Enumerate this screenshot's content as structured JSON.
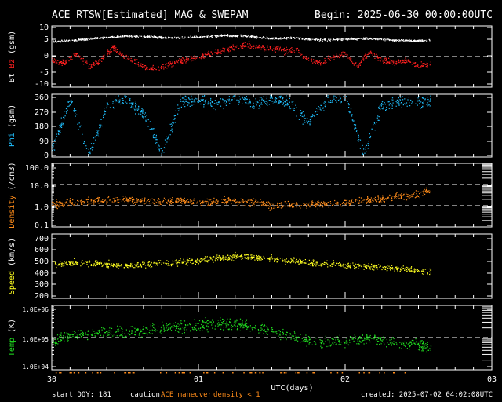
{
  "header": {
    "title": "ACE RTSW[Estimated] MAG & SWEPAM",
    "begin": "Begin: 2025-06-30 00:00:00UTC"
  },
  "footer": {
    "start_doy": "start DOY: 181",
    "caution_label": "caution:",
    "caution_maneuver": "ACE maneuver",
    "caution_density": "density < 1",
    "created": "created: 2025-07-02 04:02:08UTC"
  },
  "colors": {
    "white": "#ffffff",
    "bz": "#ff2020",
    "phi": "#20c0ff",
    "density": "#ff8c1a",
    "speed": "#ffff20",
    "temp": "#20e020",
    "maneuver": "#ff8c1a",
    "density_flag": "#ff8c1a"
  },
  "chart_data": [
    {
      "type": "scatter",
      "ylabel_parts": [
        "Bt",
        "Bz",
        "(gsm)"
      ],
      "yticks": [
        "10",
        "5",
        "0",
        "-5",
        "-10"
      ],
      "ylim": [
        -10,
        10
      ],
      "reference_lines": [
        0
      ],
      "series": [
        {
          "name": "Bt",
          "color": "white",
          "x": [
            0,
            4,
            8,
            12,
            16,
            20,
            24,
            28,
            32,
            36,
            40,
            44,
            48,
            52,
            56,
            60,
            62
          ],
          "values": [
            5.0,
            5.5,
            6.2,
            6.8,
            6.5,
            6.2,
            6.5,
            7.0,
            6.8,
            6.0,
            6.2,
            5.5,
            5.8,
            6.0,
            5.5,
            5.2,
            5.5
          ]
        },
        {
          "name": "Bz",
          "color": "bz",
          "x": [
            0,
            2,
            4,
            6,
            8,
            10,
            12,
            14,
            16,
            18,
            20,
            22,
            24,
            26,
            28,
            30,
            32,
            34,
            36,
            38,
            40,
            42,
            44,
            46,
            48,
            50,
            52,
            54,
            56,
            58,
            60,
            62
          ],
          "values": [
            -1,
            -2,
            1,
            -3,
            -1,
            3,
            0,
            -2,
            -4,
            -3,
            -2,
            -1,
            0,
            1,
            2,
            3,
            4,
            3,
            3,
            2,
            2,
            -1,
            -2,
            0,
            1,
            -3,
            2,
            -1,
            -2,
            -1,
            -3,
            -2
          ]
        }
      ]
    },
    {
      "type": "scatter",
      "ylabel_parts": [
        "Phi",
        "(gsm)"
      ],
      "yticks": [
        "360",
        "270",
        "180",
        "90",
        "0"
      ],
      "ylim": [
        0,
        360
      ],
      "series": [
        {
          "name": "Phi",
          "color": "phi",
          "x": [
            0,
            3,
            6,
            9,
            12,
            15,
            18,
            21,
            24,
            27,
            30,
            33,
            36,
            39,
            42,
            45,
            48,
            51,
            54,
            57,
            60,
            62
          ],
          "values": [
            40,
            330,
            5,
            300,
            340,
            250,
            20,
            320,
            330,
            310,
            345,
            300,
            340,
            310,
            200,
            330,
            355,
            20,
            300,
            320,
            320,
            320
          ]
        }
      ]
    },
    {
      "type": "scatter",
      "ylabel_parts": [
        "Density",
        "(/cm3)"
      ],
      "yticks": [
        "100.0",
        "10.0",
        "1.0",
        "0.1"
      ],
      "ylim": [
        0.1,
        100
      ],
      "scale": "log",
      "reference_lines": [
        1,
        10
      ],
      "series": [
        {
          "name": "Density",
          "color": "density",
          "x": [
            0,
            4,
            8,
            12,
            16,
            20,
            24,
            28,
            32,
            36,
            40,
            44,
            48,
            52,
            56,
            60,
            62
          ],
          "values": [
            1.2,
            1.5,
            1.8,
            2.0,
            1.5,
            1.8,
            1.5,
            1.8,
            1.6,
            1.0,
            1.2,
            1.3,
            1.5,
            1.8,
            2.5,
            3.5,
            6.0
          ]
        }
      ]
    },
    {
      "type": "scatter",
      "ylabel_parts": [
        "Speed",
        "(km/s)"
      ],
      "yticks": [
        "700",
        "600",
        "500",
        "400",
        "300",
        "200"
      ],
      "ylim": [
        200,
        700
      ],
      "series": [
        {
          "name": "Speed",
          "color": "speed",
          "x": [
            0,
            4,
            8,
            12,
            16,
            20,
            24,
            28,
            32,
            36,
            40,
            44,
            48,
            52,
            56,
            60,
            62
          ],
          "values": [
            470,
            480,
            470,
            455,
            470,
            480,
            500,
            520,
            530,
            510,
            490,
            470,
            460,
            450,
            440,
            420,
            410
          ]
        }
      ]
    },
    {
      "type": "scatter",
      "ylabel_parts": [
        "Temp",
        "(K)"
      ],
      "yticks": [
        "1.0E+06",
        "1.0E+05",
        "1.0E+04"
      ],
      "ylim": [
        10000,
        1000000
      ],
      "scale": "log",
      "reference_lines": [
        100000
      ],
      "series": [
        {
          "name": "Temp",
          "color": "temp",
          "x": [
            0,
            4,
            8,
            12,
            16,
            20,
            24,
            28,
            32,
            36,
            40,
            44,
            48,
            52,
            56,
            60,
            62
          ],
          "values": [
            80000,
            130000,
            150000,
            140000,
            170000,
            230000,
            250000,
            280000,
            240000,
            160000,
            100000,
            70000,
            80000,
            100000,
            70000,
            60000,
            50000
          ]
        }
      ]
    }
  ],
  "x_axis": {
    "tick_labels": [
      "30",
      "01",
      "02",
      "03"
    ],
    "label": "UTC(days)",
    "range_hours": [
      0,
      72
    ]
  }
}
